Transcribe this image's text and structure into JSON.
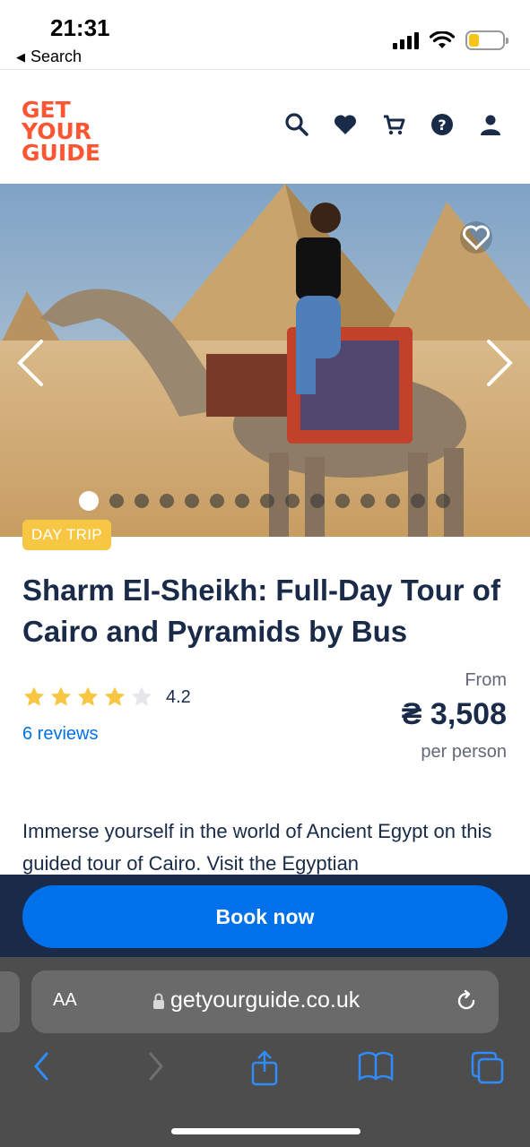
{
  "status_bar": {
    "time": "21:31",
    "back_label": "Search",
    "icons": [
      "signal-icon",
      "wifi-icon",
      "battery-icon"
    ]
  },
  "header": {
    "logo_lines": [
      "GET",
      "YOUR",
      "GUIDE"
    ],
    "icons": [
      "search-icon",
      "heart-icon",
      "cart-icon",
      "help-icon",
      "user-icon"
    ],
    "brand_color": "#ff5533"
  },
  "hero": {
    "slide_count": 15,
    "active_slide": 1,
    "icons": [
      "chevron-left-icon",
      "chevron-right-icon",
      "heart-outline-icon"
    ]
  },
  "badge": "DAY TRIP",
  "title": "Sharm El-Sheikh: Full-Day Tour of Cairo and Pyramids by Bus",
  "rating": {
    "value": "4.2",
    "stars_filled": 4,
    "stars_total": 5,
    "reviews": "6 reviews"
  },
  "price": {
    "from_label": "From",
    "amount": "₴ 3,508",
    "per_label": "per person"
  },
  "description": "Immerse yourself in the world of Ancient Egypt on this guided tour of Cairo. Visit the Egyptian",
  "cta": {
    "book_label": "Book now",
    "accent": "#0071eb",
    "bar_color": "#1a2b49"
  },
  "browser": {
    "aa_label": "AA",
    "url": "getyourguide.co.uk",
    "icons": [
      "back-icon",
      "forward-icon",
      "share-icon",
      "bookmarks-icon",
      "tabs-icon",
      "lock-icon",
      "reload-icon"
    ]
  }
}
